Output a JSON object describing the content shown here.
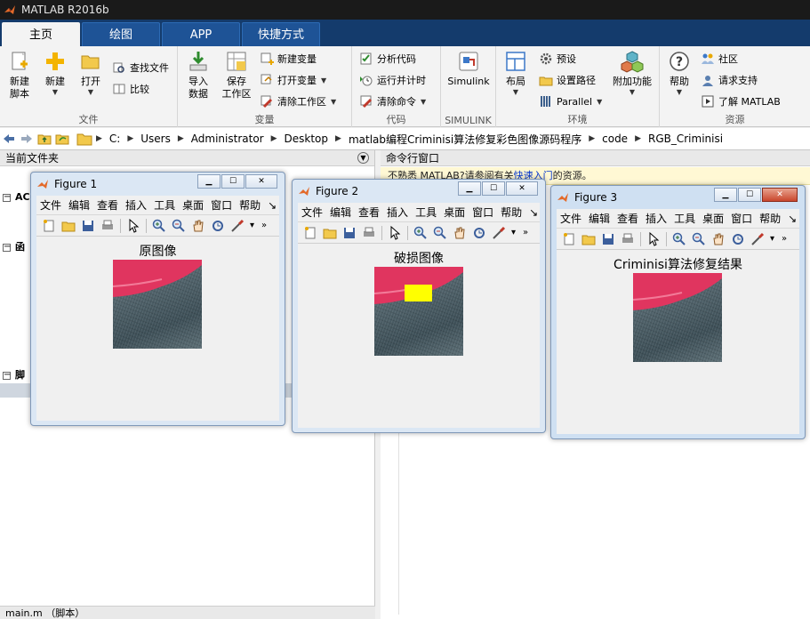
{
  "app": {
    "title": "MATLAB R2016b"
  },
  "tabs": [
    {
      "label": "主页",
      "active": true
    },
    {
      "label": "绘图",
      "active": false
    },
    {
      "label": "APP",
      "active": false
    },
    {
      "label": "快捷方式",
      "active": false
    }
  ],
  "ribbon": {
    "file": {
      "label": "文件",
      "new_script": "新建\n脚本",
      "new": "新建",
      "open": "打开",
      "find_files": "查找文件",
      "compare": "比较"
    },
    "variable": {
      "label": "变量",
      "import": "导入\n数据",
      "save_ws": "保存\n工作区",
      "new_var": "新建变量",
      "open_var": "打开变量",
      "clear_ws": "清除工作区"
    },
    "code": {
      "label": "代码",
      "analyze": "分析代码",
      "run_time": "运行并计时",
      "clear_cmd": "清除命令"
    },
    "simulink": {
      "label": "SIMULINK",
      "simulink": "Simulink"
    },
    "env": {
      "label": "环境",
      "layout": "布局",
      "prefs": "预设",
      "set_path": "设置路径",
      "parallel": "Parallel",
      "addons": "附加功能"
    },
    "resources": {
      "label": "资源",
      "help": "帮助",
      "community": "社区",
      "support": "请求支持",
      "learn": "了解 MATLAB"
    }
  },
  "address": {
    "crumbs": [
      "C:",
      "Users",
      "Administrator",
      "Desktop",
      "matlab编程Criminisi算法修复彩色图像源码程序",
      "code",
      "RGB_Criminisi"
    ]
  },
  "left_panel": {
    "title": "当前文件夹",
    "sections": [
      "AC",
      "函",
      "脚"
    ],
    "detail": "main.m （脚本）"
  },
  "cmd_panel": {
    "title": "命令行窗口",
    "notice_pre": "不熟悉 MATLAB?请参阅有关",
    "notice_link": "快速入门",
    "notice_post": "的资源。"
  },
  "figure_menu": [
    "文件",
    "编辑",
    "查看",
    "插入",
    "工具",
    "桌面",
    "窗口",
    "帮助"
  ],
  "figures": [
    {
      "title": "Figure 1",
      "axes_title": "原图像"
    },
    {
      "title": "Figure 2",
      "axes_title": "破损图像"
    },
    {
      "title": "Figure 3",
      "axes_title": "Criminisi算法修复结果"
    }
  ],
  "colors": {
    "tab_bar": "#143b6c",
    "tab": "#1e5396",
    "damage_patch": "#ffff00",
    "petal": "#e0355f"
  }
}
